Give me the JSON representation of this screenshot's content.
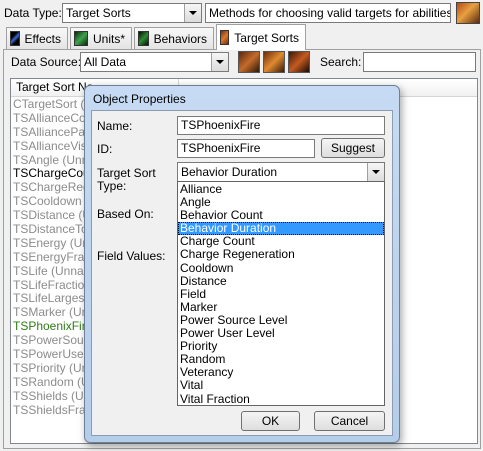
{
  "toolbar": {
    "data_type_label": "Data Type:",
    "data_type_value": "Target Sorts",
    "description": "Methods for choosing valid targets for abilities or"
  },
  "tabs": [
    {
      "label": "Effects",
      "icon": "effects-icon",
      "active": false
    },
    {
      "label": "Units*",
      "icon": "units-icon",
      "active": false
    },
    {
      "label": "Behaviors",
      "icon": "behaviors-icon",
      "active": false
    },
    {
      "label": "Target Sorts",
      "icon": "target-sorts-icon",
      "active": true
    }
  ],
  "filter": {
    "data_source_label": "Data Source:",
    "data_source_value": "All Data",
    "search_label": "Search:",
    "search_value": ""
  },
  "list": {
    "column_header": "Target Sort Na",
    "items": [
      {
        "text": "CTargetSort (U",
        "style": "gray"
      },
      {
        "text": "TSAllianceCom",
        "style": "gray"
      },
      {
        "text": "TSAlliancePas",
        "style": "gray"
      },
      {
        "text": "TSAllianceVisi",
        "style": "gray"
      },
      {
        "text": "TSAngle (Unna",
        "style": "gray"
      },
      {
        "text": "TSChargeCoun",
        "style": "bold"
      },
      {
        "text": "TSChargeRege",
        "style": "gray"
      },
      {
        "text": "TSCooldown (U",
        "style": "gray"
      },
      {
        "text": "TSDistance (U",
        "style": "gray"
      },
      {
        "text": "TSDistanceTo",
        "style": "gray"
      },
      {
        "text": "TSEnergy (Unr",
        "style": "gray"
      },
      {
        "text": "TSEnergyFract",
        "style": "gray"
      },
      {
        "text": "TSLife (Unnam",
        "style": "gray"
      },
      {
        "text": "TSLifeFraction",
        "style": "gray"
      },
      {
        "text": "TSLifeLargestF",
        "style": "gray"
      },
      {
        "text": "TSMarker (Unn",
        "style": "gray"
      },
      {
        "text": "TSPhoenixFire",
        "style": "green"
      },
      {
        "text": "TSPowerSourc",
        "style": "gray"
      },
      {
        "text": "TSPowerUser (",
        "style": "gray"
      },
      {
        "text": "TSPriority (Un",
        "style": "gray"
      },
      {
        "text": "TSRandom (Ur",
        "style": "gray"
      },
      {
        "text": "TSShields (Unr",
        "style": "gray"
      },
      {
        "text": "TSShieldsFract",
        "style": "gray"
      }
    ]
  },
  "dialog": {
    "title": "Object Properties",
    "name_label": "Name:",
    "name_value": "TSPhoenixFire",
    "id_label": "ID:",
    "id_value": "TSPhoenixFire",
    "suggest_label": "Suggest",
    "type_label_line1": "Target Sort",
    "type_label_line2": "Type:",
    "type_value": "Behavior Duration",
    "based_on_label": "Based On:",
    "field_values_label": "Field Values:",
    "options": [
      "Alliance",
      "Angle",
      "Behavior Count",
      "Behavior Duration",
      "Charge Count",
      "Charge Regeneration",
      "Cooldown",
      "Distance",
      "Field",
      "Marker",
      "Power Source Level",
      "Power User Level",
      "Priority",
      "Random",
      "Veterancy",
      "Vital",
      "Vital Fraction"
    ],
    "selected_index": 3,
    "ok_label": "OK",
    "cancel_label": "Cancel"
  }
}
